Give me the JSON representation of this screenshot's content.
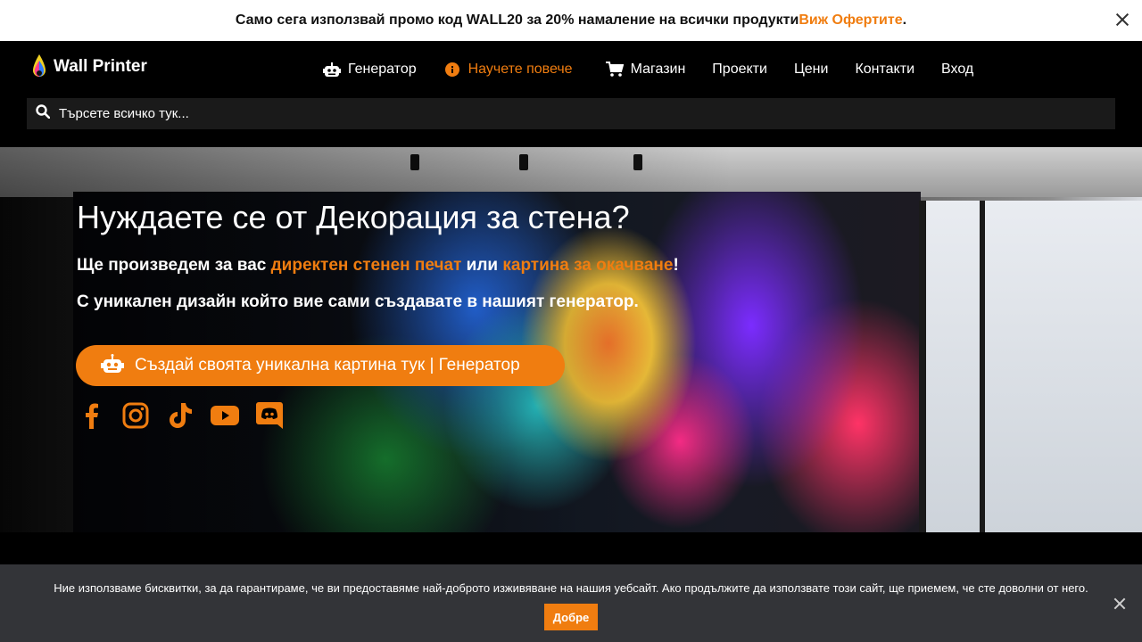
{
  "promo": {
    "text": "Само сега използвай промо код WALL20 за 20% намаление на всички продукти ",
    "link": "Виж Офертите",
    "suffix": "."
  },
  "header": {
    "logo_text": "Wall Printer",
    "nav": [
      {
        "label": "Генератор",
        "icon": "robot-icon"
      },
      {
        "label": "Научете повече",
        "icon": "info-icon",
        "active": true
      },
      {
        "label": "Магазин",
        "icon": "cart-icon"
      },
      {
        "label": "Проекти"
      },
      {
        "label": "Цени"
      },
      {
        "label": "Контакти"
      },
      {
        "label": "Вход"
      }
    ],
    "search_placeholder": "Търсете всичко тук..."
  },
  "hero": {
    "title": "Нуждаете се от Декорация за стена?",
    "line1_prefix": "Ще произведем за вас ",
    "line1_link1": "директен стенен печат",
    "line1_middle": " или ",
    "line1_link2": "картина за окачване",
    "line1_suffix": "!",
    "line2": "С уникален дизайн който вие сами създавате в нашият генератор.",
    "cta_label": "Създай своята уникална картина тук | Генератор",
    "socials": [
      "facebook-icon",
      "instagram-icon",
      "tiktok-icon",
      "youtube-icon",
      "discord-icon"
    ]
  },
  "cookie": {
    "text": "Ние използваме бисквитки, за да гарантираме, че ви предоставяме най-доброто изживяване на нашия уебсайт. Ако продължите да използвате този сайт, ще приемем, че сте доволни от него.",
    "button": "Добре"
  },
  "colors": {
    "accent": "#f07d10",
    "header_bg": "#000000",
    "search_bg": "#1a1a1a",
    "cookie_bg": "#333438"
  }
}
